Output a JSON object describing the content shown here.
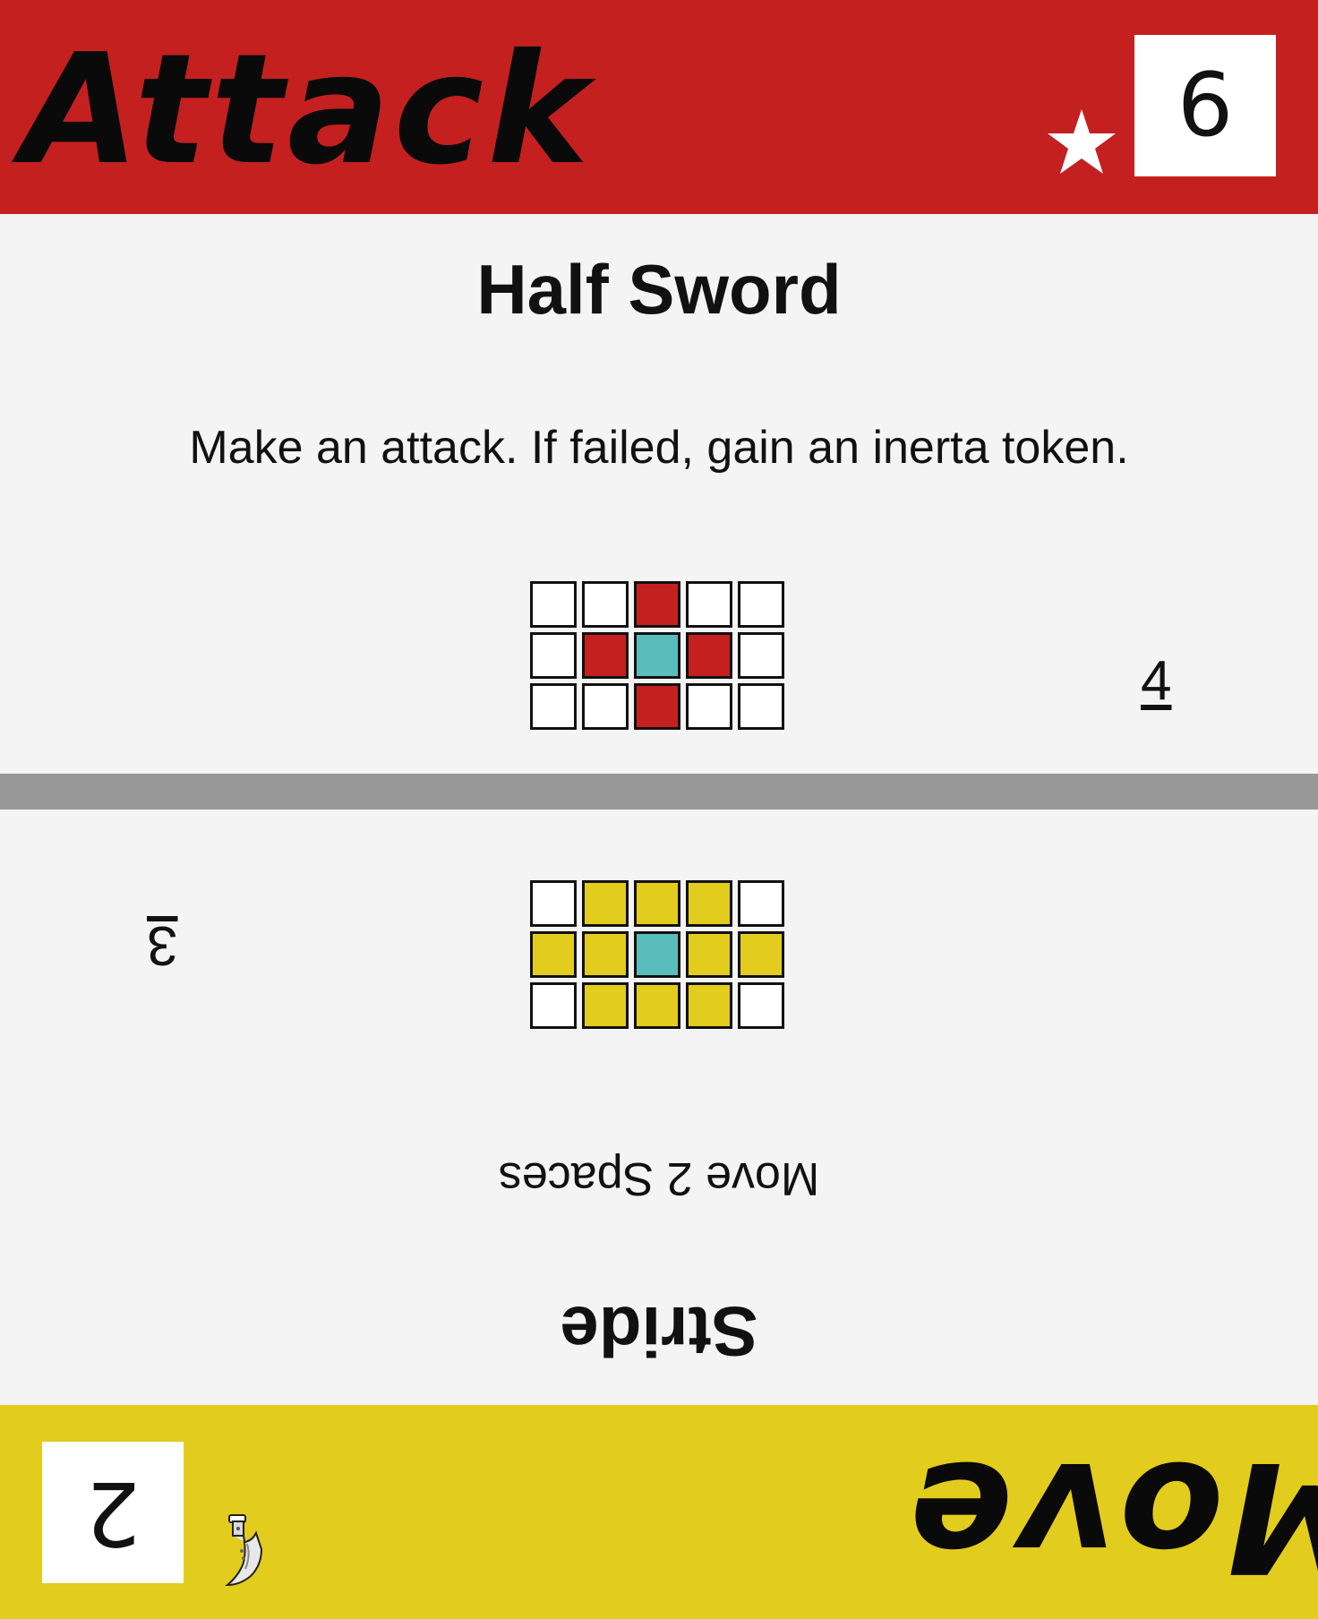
{
  "top_card": {
    "type_label": "Attack",
    "cost": "6",
    "name": "Half Sword",
    "description": "Make an attack. If failed, gain an inerta token.",
    "speed": "4",
    "band_color": "#c42020",
    "icon": "star-icon",
    "pattern": [
      [
        "empty",
        "empty",
        "hit",
        "empty",
        "empty"
      ],
      [
        "empty",
        "hit",
        "self",
        "hit",
        "empty"
      ],
      [
        "empty",
        "empty",
        "hit",
        "empty",
        "empty"
      ]
    ]
  },
  "bottom_card": {
    "type_label": "Move",
    "cost": "2",
    "name": "Stride",
    "description": "Move 2 Spaces",
    "speed": "3",
    "band_color": "#e2cc1e",
    "icon": "dagger-icon",
    "pattern": [
      [
        "empty",
        "move",
        "move",
        "move",
        "empty"
      ],
      [
        "move",
        "move",
        "self",
        "move",
        "move"
      ],
      [
        "empty",
        "move",
        "move",
        "move",
        "empty"
      ]
    ]
  },
  "palette": {
    "hit": "#c42020",
    "move": "#e2cc1e",
    "self": "#5bbcbc",
    "empty": "#ffffff",
    "divider": "#999999"
  }
}
